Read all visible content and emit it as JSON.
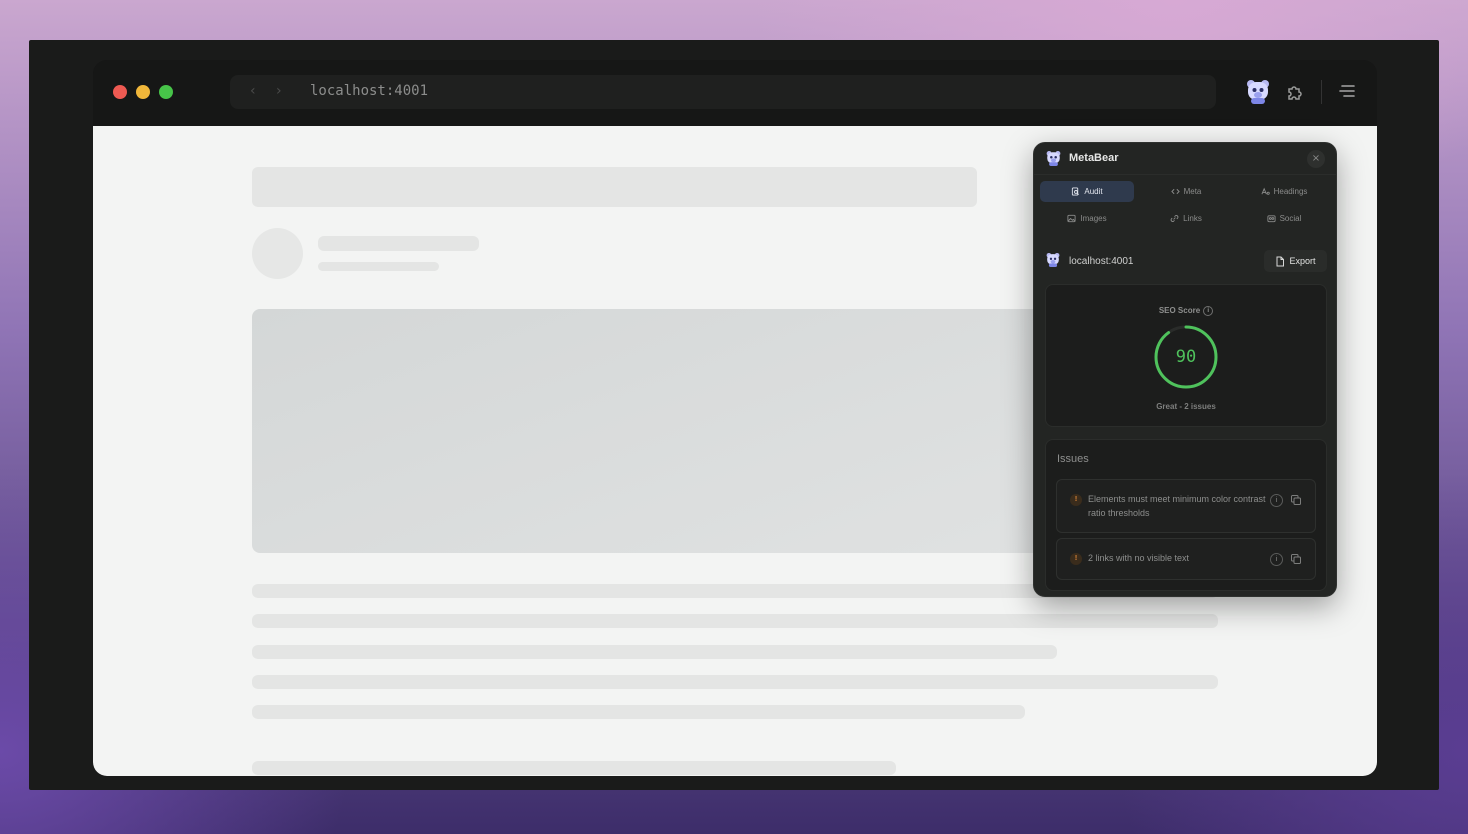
{
  "browser": {
    "url": "localhost:4001",
    "nav_back_icon": "‹",
    "nav_forward_icon": "›",
    "toolbar_icons": [
      "metabear-extension-icon",
      "puzzle-extensions-icon",
      "menu-icon"
    ]
  },
  "extension": {
    "name": "MetaBear",
    "close_glyph": "×",
    "tabs": [
      {
        "label": "Audit",
        "icon": "audit-icon",
        "active": true
      },
      {
        "label": "Meta",
        "icon": "code-icon",
        "active": false
      },
      {
        "label": "Headings",
        "icon": "text-icon",
        "active": false
      },
      {
        "label": "Images",
        "icon": "image-icon",
        "active": false
      },
      {
        "label": "Links",
        "icon": "link-icon",
        "active": false
      },
      {
        "label": "Social",
        "icon": "share-icon",
        "active": false
      }
    ],
    "site": {
      "host": "localhost:4001",
      "export_label": "Export"
    },
    "score": {
      "label": "SEO Score",
      "info_glyph": "i",
      "value": 90,
      "display": "90",
      "max": 100,
      "status": "Great - 2 issues",
      "color": "#4fc25c"
    },
    "issues": {
      "title": "Issues",
      "items": [
        {
          "text": "Elements must meet minimum color contrast ratio thresholds",
          "severity_glyph": "!",
          "info_glyph": "i"
        },
        {
          "text": "2 links with no visible text",
          "severity_glyph": "!",
          "info_glyph": "i"
        }
      ]
    }
  },
  "colors": {
    "accent_tab": "#2f3a4d",
    "score_green": "#4fc25c",
    "warning": "#e28a3a"
  }
}
